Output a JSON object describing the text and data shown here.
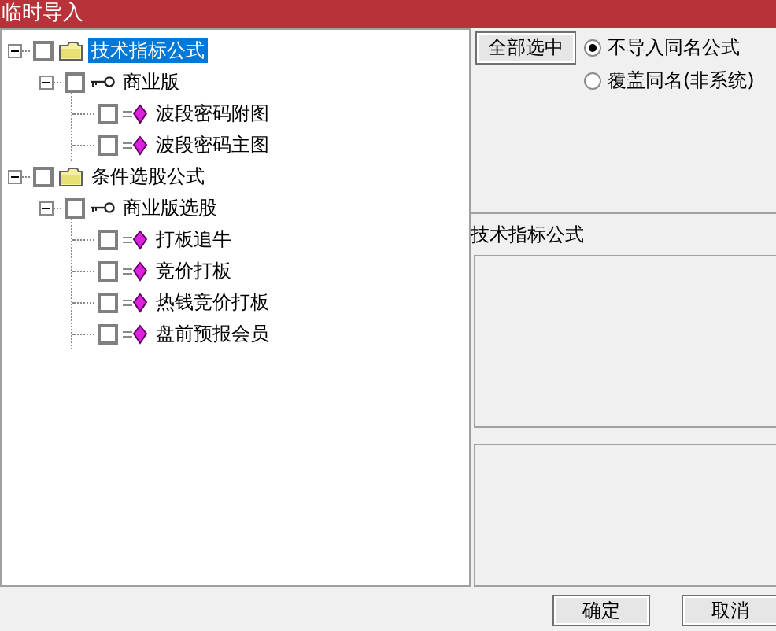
{
  "window": {
    "title": "临时导入"
  },
  "tree": [
    {
      "kind": "folder",
      "label": "技术指标公式",
      "selected": true,
      "checked": false,
      "expanded": true,
      "children": [
        {
          "kind": "key",
          "label": "商业版",
          "selected": false,
          "checked": false,
          "expanded": true,
          "children": [
            {
              "kind": "formula",
              "label": "波段密码附图",
              "selected": false,
              "checked": false
            },
            {
              "kind": "formula",
              "label": "波段密码主图",
              "selected": false,
              "checked": false
            }
          ]
        }
      ]
    },
    {
      "kind": "folder",
      "label": "条件选股公式",
      "selected": false,
      "checked": false,
      "expanded": true,
      "children": [
        {
          "kind": "key",
          "label": "商业版选股",
          "selected": false,
          "checked": false,
          "expanded": true,
          "children": [
            {
              "kind": "formula",
              "label": "打板追牛",
              "selected": false,
              "checked": false
            },
            {
              "kind": "formula",
              "label": "竞价打板",
              "selected": false,
              "checked": false
            },
            {
              "kind": "formula",
              "label": "热钱竞价打板",
              "selected": false,
              "checked": false
            },
            {
              "kind": "formula",
              "label": "盘前预报会员",
              "selected": false,
              "checked": false
            }
          ]
        }
      ]
    }
  ],
  "select_all_button": "全部选中",
  "import_options": [
    {
      "label": "不导入同名公式",
      "selected": true
    },
    {
      "label": "覆盖同名(非系统)",
      "selected": false
    }
  ],
  "preview_label": "技术指标公式",
  "buttons": [
    "确定",
    "取消"
  ]
}
